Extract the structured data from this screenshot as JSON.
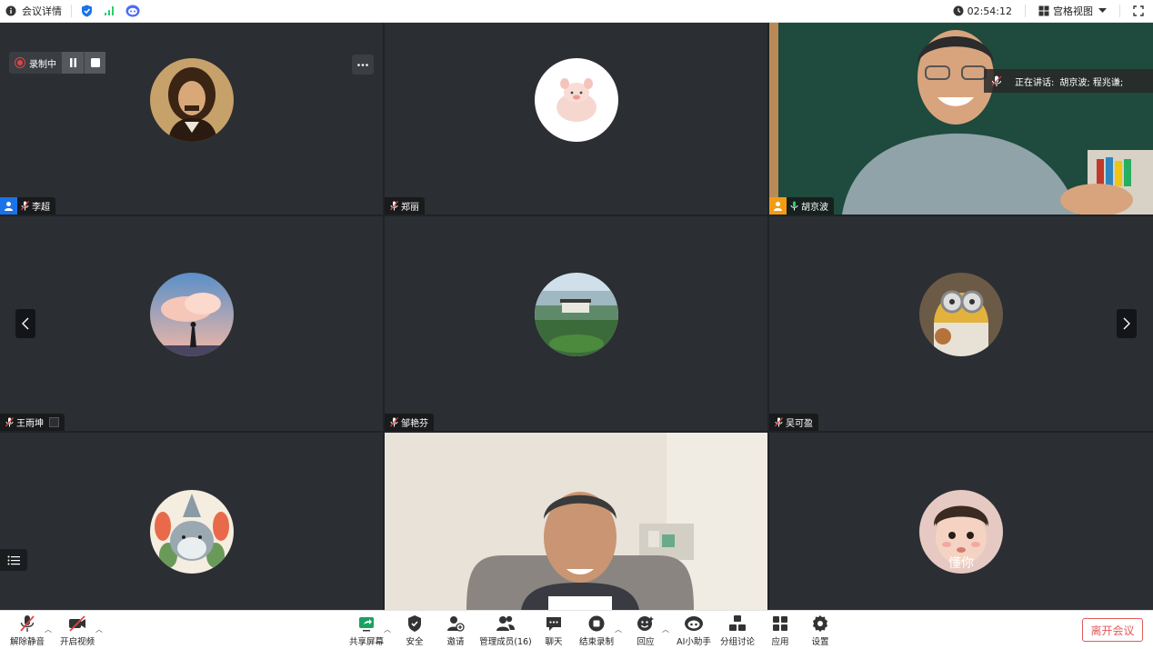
{
  "topbar": {
    "meeting_info_label": "会议详情",
    "timer": "02:54:12",
    "view_mode_label": "宫格视图"
  },
  "recording": {
    "label": "录制中"
  },
  "speaking": {
    "label": "正在讲话:",
    "names": "胡京波; 程兆谦;"
  },
  "participants": [
    {
      "name": "李超"
    },
    {
      "name": "郑丽"
    },
    {
      "name": "胡京波"
    },
    {
      "name": "王雨坤"
    },
    {
      "name": "邹艳芬"
    },
    {
      "name": "吴可盈"
    },
    {
      "name": ""
    },
    {
      "name": ""
    },
    {
      "name": ""
    }
  ],
  "toolbar": {
    "unmute": "解除静音",
    "start_video": "开启视频",
    "share_screen": "共享屏幕",
    "security": "安全",
    "invite": "邀请",
    "manage_members": "管理成员(16)",
    "chat": "聊天",
    "end_recording": "结束录制",
    "reactions": "回应",
    "ai_assistant": "AI小助手",
    "breakout": "分组讨论",
    "apps": "应用",
    "settings": "设置",
    "leave": "离开会议"
  },
  "avatar_text": {
    "dong_ni": "懂你"
  },
  "colors": {
    "active_border": "#2ecc71",
    "leave": "#e35a5a",
    "tile_bg": "#2b2e32",
    "grid_bg": "#1f2226"
  }
}
